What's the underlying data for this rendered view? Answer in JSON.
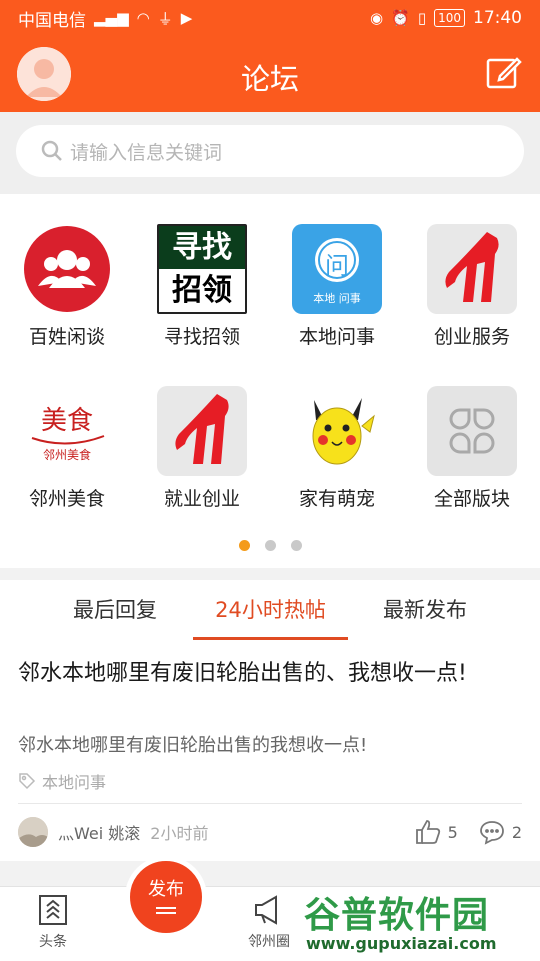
{
  "statusbar": {
    "carrier": "中国电信",
    "network": "4G",
    "battery": "100",
    "time": "17:40"
  },
  "header": {
    "title": "论坛"
  },
  "search": {
    "placeholder": "请输入信息关键词"
  },
  "categories": [
    {
      "label": "百姓闲谈",
      "icon": "people-icon",
      "color": "#d9202d"
    },
    {
      "label": "寻找招领",
      "icon": "lost-found-icon",
      "icon_text_top": "寻找",
      "icon_text_bottom": "招领"
    },
    {
      "label": "本地问事",
      "icon": "question-icon",
      "icon_text": "问",
      "icon_caption": "本地 问事",
      "color": "#3aa3e6"
    },
    {
      "label": "创业服务",
      "icon": "flame-logo-icon",
      "color": "#e61d25"
    },
    {
      "label": "邻州美食",
      "icon": "food-logo-icon",
      "icon_text": "美食",
      "icon_caption": "邻州美食"
    },
    {
      "label": "就业创业",
      "icon": "flame-logo-icon",
      "color": "#e61d25"
    },
    {
      "label": "家有萌宠",
      "icon": "pet-icon",
      "color": "#f7e11b"
    },
    {
      "label": "全部版块",
      "icon": "clover-grid-icon",
      "color": "#bdbdbd"
    }
  ],
  "pager": {
    "total": 3,
    "active": 0,
    "active_color": "#f49b1a"
  },
  "tabs": [
    {
      "label": "最后回复"
    },
    {
      "label": "24小时热帖"
    },
    {
      "label": "最新发布"
    }
  ],
  "active_tab": 1,
  "post": {
    "title": "邻水本地哪里有废旧轮胎出售的、我想收一点!",
    "excerpt": "邻水本地哪里有废旧轮胎出售的我想收一点!",
    "tag": "本地问事",
    "author": "灬Wei 姚滚",
    "time": "2小时前",
    "likes": "5",
    "comments": "2"
  },
  "bottom_nav": {
    "home_label": "头条",
    "publish_label": "发布",
    "circle_label": "邻州圈"
  },
  "watermark": {
    "brand": "谷普软件园",
    "url": "www.gupuxiazai.com"
  },
  "colors": {
    "brand": "#fb5a1e",
    "accent": "#e04b22"
  }
}
